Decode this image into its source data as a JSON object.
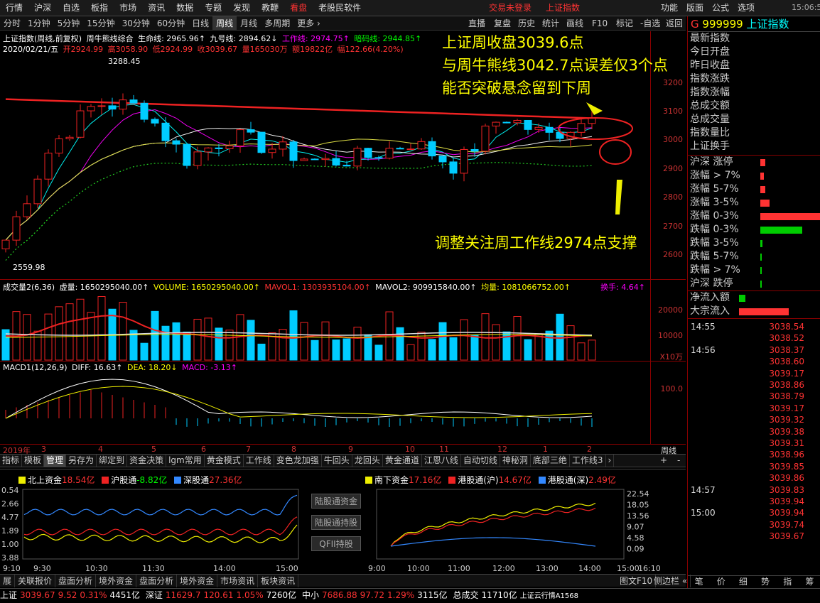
{
  "menubar": {
    "left": [
      "行情",
      "沪深",
      "自选",
      "板指",
      "市场",
      "资讯",
      "数据",
      "专题",
      "发现",
      "教鞭"
    ],
    "active": "看盘",
    "software": "老股民软件",
    "login": "交易未登录",
    "index_name": "上证指数",
    "right": [
      "功能",
      "版面",
      "公式",
      "选项"
    ],
    "clock": "15:06:5"
  },
  "tfbar": {
    "items": [
      "分时",
      "1分钟",
      "5分钟",
      "15分钟",
      "30分钟",
      "60分钟",
      "日线",
      "周线",
      "月线",
      "多周期",
      "更多 ›"
    ],
    "selected": "周线",
    "right": [
      "直播",
      "复盘",
      "历史",
      "统计",
      "画线",
      "F10",
      "标记",
      "-自选",
      "返回"
    ]
  },
  "kline": {
    "titleline": [
      "上证指数(周线,前复权)",
      "周牛熊线综合",
      "生命线: 2965.96↑",
      "九号线: 2894.62↓",
      "工作线: 2974.75↑",
      "暗码线: 2944.85↑"
    ],
    "dateline": [
      "2020/02/21/五",
      "开2924.99",
      "高3058.90",
      "低2924.99",
      "收3039.67",
      "量165030万",
      "额19822亿",
      "幅122.66(4.20%)"
    ],
    "axis": [
      "3200",
      "3100",
      "3000",
      "2900",
      "2800",
      "2700",
      "2600"
    ],
    "hi_label": "3288.45",
    "lo_label": "2559.98",
    "annotations": [
      "上证周收盘3039.6点",
      "与周牛熊线3042.7点误差仅3个点",
      "能否突破悬念留到下周",
      "调整关注周工作线2974点支撑"
    ]
  },
  "volume": {
    "title": "成交量2(6,36)",
    "line": [
      "虚量: 1650295040.00↑",
      "VOLUME: 1650295040.00↑",
      "MAVOL1: 1303935104.00↑",
      "MAVOL2: 909915840.00↑",
      "均量: 1081066752.00↑"
    ],
    "turnover": "换手: 4.64↑",
    "axis": [
      "20000",
      "10000"
    ],
    "unit": "X10万"
  },
  "macd": {
    "title": "MACD1(12,26,9)",
    "diff": "DIFF: 16.63↑",
    "dea": "DEA: 18.20↓",
    "macd": "MACD: -3.13↑",
    "axis": "100.0"
  },
  "timeaxis": [
    "2019年",
    "3",
    "4",
    "5",
    "6",
    "7",
    "8",
    "9",
    "10",
    "11",
    "12",
    "1",
    "2"
  ],
  "timeaxis_right": "周线",
  "indtabs": [
    "指标",
    "模板",
    "管理",
    "另存为",
    "绑定到",
    "资金决策",
    "lgm常用",
    "黄金模式",
    "工作线",
    "变色龙加强",
    "牛回头",
    "龙回头",
    "黄金通道",
    "江恩八线",
    "自动切线",
    "神秘洞",
    "底部三绝",
    "工作线3"
  ],
  "flow": {
    "north": {
      "label": "北上资金",
      "value": "18.54亿",
      "sh": "沪股通",
      "sh_val": "-8.82亿",
      "sz": "深股通",
      "sz_val": "27.36亿",
      "axis": [
        "0.54",
        "2.66",
        "4.77",
        "1.89",
        "1.00",
        "3.88"
      ],
      "times": [
        "9:10",
        "9:30",
        "10:30",
        "11:30",
        "14:00",
        "15:00"
      ]
    },
    "buttons": [
      "陆股通资金",
      "陆股通持股",
      "QFII持股"
    ],
    "south": {
      "label": "南下资金",
      "value": "17.16亿",
      "hk_sh": "港股通(沪)",
      "hk_sh_val": "14.67亿",
      "hk_sz": "港股通(深)",
      "hk_sz_val": "2.49亿",
      "axis": [
        "22.54",
        "18.05",
        "13.56",
        "9.07",
        "4.58",
        "0.09"
      ],
      "times": [
        "9:00",
        "10:00",
        "11:00",
        "12:00",
        "13:00",
        "14:00",
        "15:00",
        "16:10"
      ]
    }
  },
  "bottomtabs": [
    "展",
    "关联报价",
    "盘面分析",
    "境外资金",
    "盘面分析",
    "境外资金",
    "市场资讯",
    "板块资讯"
  ],
  "bottomtabs_right": [
    "图文F10",
    "侧边栏 «"
  ],
  "statusbar": {
    "sh": "上证",
    "sh_price": "3039.67",
    "sh_chg": "9.52",
    "sh_pct": "0.31%",
    "sh_amt": "4451亿",
    "sz": "深证",
    "sz_price": "11629.7",
    "sz_chg": "120.61",
    "sz_pct": "1.05%",
    "sz_amt": "7260亿",
    "zx": "中小",
    "zx_price": "7686.88",
    "zx_chg": "97.72",
    "zx_pct": "1.29%",
    "zx_amt": "3115亿",
    "total": "总成交",
    "total_amt": "11710亿",
    "tail": "上证云行情A1568"
  },
  "side": {
    "code": "G",
    "symbol": "999999",
    "name": "上证指数",
    "fields": [
      "最新指数",
      "今日开盘",
      "昨日收盘",
      "指数涨跌",
      "指数涨幅",
      "总成交额",
      "总成交量",
      "指数量比",
      "上证换手"
    ],
    "breadth": [
      {
        "label": "沪深 涨停",
        "color": "#f33",
        "frac": 0.08
      },
      {
        "label": "涨幅 > 7%",
        "color": "#f33",
        "frac": 0.06
      },
      {
        "label": "涨幅 5-7%",
        "color": "#f33",
        "frac": 0.08
      },
      {
        "label": "涨幅 3-5%",
        "color": "#f33",
        "frac": 0.16
      },
      {
        "label": "涨幅 0-3%",
        "color": "#f33",
        "frac": 1.0
      },
      {
        "label": "跌幅 0-3%",
        "color": "#0c0",
        "frac": 0.7
      },
      {
        "label": "跌幅 3-5%",
        "color": "#0c0",
        "frac": 0.04
      },
      {
        "label": "跌幅 5-7%",
        "color": "#0c0",
        "frac": 0.01
      },
      {
        "label": "跌幅 > 7%",
        "color": "#0c0",
        "frac": 0.01
      },
      {
        "label": "沪深 跌停",
        "color": "#0c0",
        "frac": 0.01
      }
    ],
    "flows": [
      {
        "label": "净流入额",
        "color": "#0c0",
        "frac": 0.09
      },
      {
        "label": "大宗流入",
        "color": "#f33",
        "frac": 0.7
      }
    ],
    "ticks": [
      {
        "time": "14:55",
        "price": "3038.54"
      },
      {
        "time": "",
        "price": "3038.52"
      },
      {
        "time": "14:56",
        "price": "3038.37"
      },
      {
        "time": "",
        "price": "3038.60"
      },
      {
        "time": "",
        "price": "3039.17"
      },
      {
        "time": "",
        "price": "3038.86"
      },
      {
        "time": "",
        "price": "3038.79"
      },
      {
        "time": "",
        "price": "3039.17"
      },
      {
        "time": "",
        "price": "3039.32"
      },
      {
        "time": "",
        "price": "3039.38"
      },
      {
        "time": "",
        "price": "3039.31"
      },
      {
        "time": "",
        "price": "3038.96"
      },
      {
        "time": "",
        "price": "3039.85"
      },
      {
        "time": "",
        "price": "3039.86"
      },
      {
        "time": "14:57",
        "price": "3039.83"
      },
      {
        "time": "",
        "price": "3039.94"
      },
      {
        "time": "15:00",
        "price": "3039.94"
      },
      {
        "time": "",
        "price": "3039.74"
      },
      {
        "time": "",
        "price": "3039.67"
      }
    ],
    "bottom": [
      "笔",
      "价",
      "细",
      "势",
      "指",
      "筹"
    ]
  },
  "chart_data": {
    "type": "bar",
    "title": "上证指数(周线,前复权)",
    "categories": [
      "2019-01",
      "2019-02",
      "2019-03",
      "2019-04",
      "2019-05",
      "2019-06",
      "2019-07",
      "2019-08",
      "2019-09",
      "2019-10",
      "2019-11",
      "2019-12",
      "2020-01",
      "2020-02"
    ],
    "series": [
      {
        "name": "收",
        "values": [
          2618,
          2940,
          3090,
          3078,
          2898,
          2978,
          2932,
          2886,
          2905,
          2958,
          2872,
          3050,
          2976,
          3039.67
        ]
      }
    ],
    "ylim": [
      2560,
      3290
    ]
  }
}
